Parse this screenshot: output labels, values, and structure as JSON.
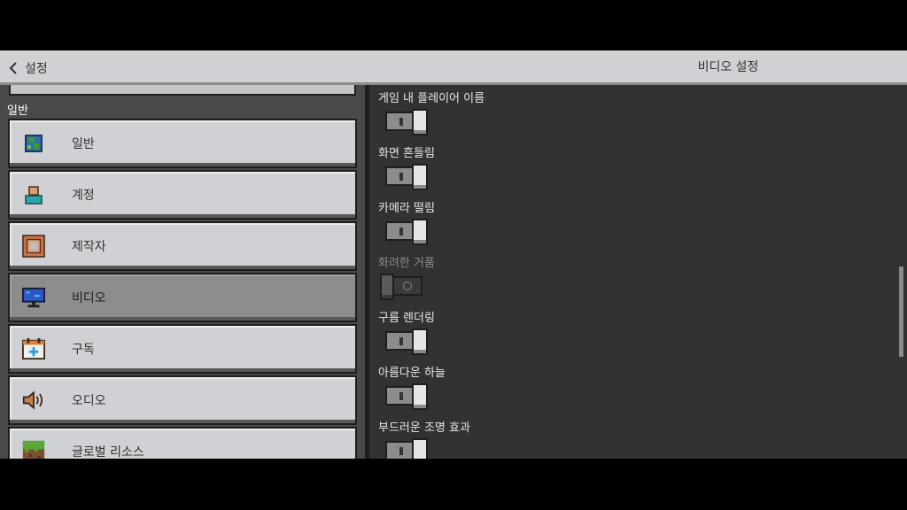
{
  "header": {
    "back_label": "설정",
    "title": "비디오 설정"
  },
  "sidebar": {
    "section_label": "일반",
    "items": [
      {
        "label": "일반",
        "icon": "globe-icon"
      },
      {
        "label": "계정",
        "icon": "account-icon"
      },
      {
        "label": "제작자",
        "icon": "creator-icon"
      },
      {
        "label": "비디오",
        "icon": "monitor-icon",
        "selected": true
      },
      {
        "label": "구독",
        "icon": "calendar-icon"
      },
      {
        "label": "오디오",
        "icon": "speaker-icon"
      },
      {
        "label": "글로벌 리소스",
        "icon": "grass-block-icon"
      }
    ]
  },
  "options": [
    {
      "label": "게임 내 플레이어 이름",
      "value": true,
      "enabled": true
    },
    {
      "label": "화면 흔들림",
      "value": true,
      "enabled": true
    },
    {
      "label": "카메라 떨림",
      "value": true,
      "enabled": true
    },
    {
      "label": "화려한 거품",
      "value": false,
      "enabled": false
    },
    {
      "label": "구름 렌더링",
      "value": true,
      "enabled": true
    },
    {
      "label": "아름다운 하늘",
      "value": true,
      "enabled": true
    },
    {
      "label": "부드러운 조명 효과",
      "value": true,
      "enabled": true
    }
  ],
  "colors": {
    "header_bg": "#d0d1d4",
    "panel_bg": "#313233",
    "button_bg": "#d0d1d4",
    "selected_bg": "#8d8d8f"
  }
}
